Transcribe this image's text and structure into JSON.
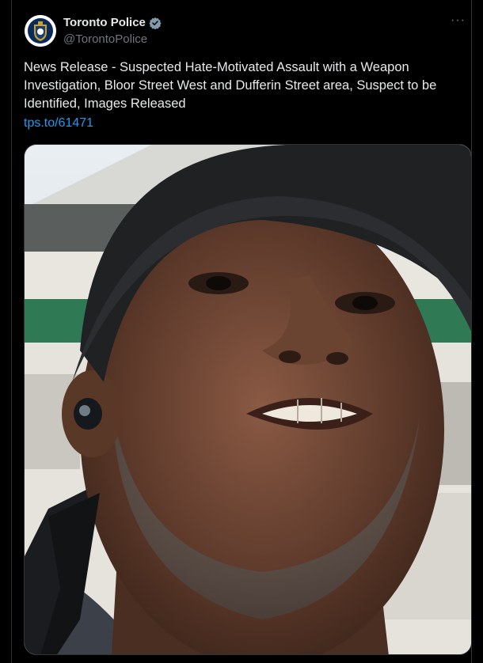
{
  "tweet": {
    "author_name": "Toronto Police",
    "author_handle": "@TorontoPolice",
    "verified_icon": "verified-badge-icon",
    "more_label": "···",
    "text": "News Release - Suspected Hate-Motivated Assault with a Weapon Investigation, Bloor Street West and Dufferin Street area, Suspect to be Identified, Images Released",
    "link": "tps.to/61471"
  },
  "colors": {
    "background": "#000000",
    "text": "#e7e9ea",
    "secondary": "#71767b",
    "link": "#1d9bf0",
    "verified": "#829aab"
  },
  "media": {
    "icon": "suspect-photo"
  }
}
